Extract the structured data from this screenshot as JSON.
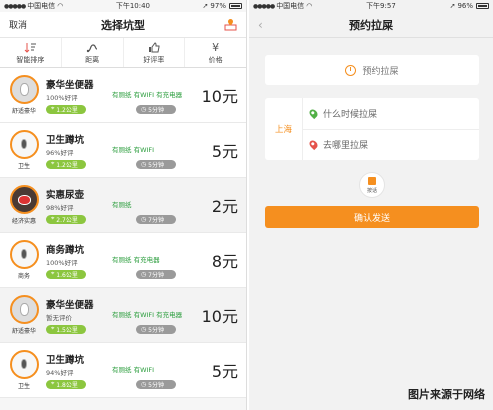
{
  "colors": {
    "accent": "#f58f1f",
    "green": "#8cc63f",
    "feature": "#2a9d3c",
    "gray_pill": "#9a9a9a"
  },
  "left": {
    "status": {
      "carrier": "中国电信",
      "time": "下午10:40",
      "battery": "97%"
    },
    "nav": {
      "cancel": "取消",
      "title": "选择坑型",
      "right_icon": "map-pin-icon"
    },
    "filters": [
      {
        "label": "智能排序",
        "icon": "sort-icon"
      },
      {
        "label": "距离",
        "icon": "distance-icon"
      },
      {
        "label": "好评率",
        "icon": "thumbs-up-icon"
      },
      {
        "label": "价格",
        "icon": "yen-icon"
      }
    ],
    "items": [
      {
        "name": "豪华坐便器",
        "rating": "100%好评",
        "features": "有厕纸 有WIFI 有充电器",
        "distance": "1.2公里",
        "time": "5分钟",
        "price": "10元",
        "tag": "舒适豪华"
      },
      {
        "name": "卫生蹲坑",
        "rating": "96%好评",
        "features": "有厕纸 有WIFI",
        "distance": "1.2公里",
        "time": "5分钟",
        "price": "5元",
        "tag": "卫生"
      },
      {
        "name": "实惠尿壶",
        "rating": "98%好评",
        "features": "有厕纸",
        "distance": "2.7公里",
        "time": "7分钟",
        "price": "2元",
        "tag": "经济实惠"
      },
      {
        "name": "商务蹲坑",
        "rating": "100%好评",
        "features": "有厕纸 有充电器",
        "distance": "1.6公里",
        "time": "7分钟",
        "price": "8元",
        "tag": "商务"
      },
      {
        "name": "豪华坐便器",
        "rating": "暂无评价",
        "features": "有厕纸 有WIFI 有充电器",
        "distance": "1.5公里",
        "time": "5分钟",
        "price": "10元",
        "tag": "舒适豪华"
      },
      {
        "name": "卫生蹲坑",
        "rating": "94%好评",
        "features": "有厕纸 有WIFI",
        "distance": "1.8公里",
        "time": "5分钟",
        "price": "5元",
        "tag": "卫生"
      }
    ]
  },
  "right": {
    "status": {
      "carrier": "中国电信",
      "time": "下午9:57",
      "battery": "96%"
    },
    "nav": {
      "back_icon": "back-chevron-icon",
      "title": "预约拉屎"
    },
    "appointment": {
      "label": "预约拉屎",
      "icon": "clock-icon"
    },
    "location": {
      "city": "上海",
      "when_placeholder": "什么时候拉屎",
      "where_placeholder": "去哪里拉屎"
    },
    "voice": {
      "label": "按话",
      "icon": "voice-icon"
    },
    "confirm": "确认发送"
  },
  "watermark": "图片来源于网络"
}
